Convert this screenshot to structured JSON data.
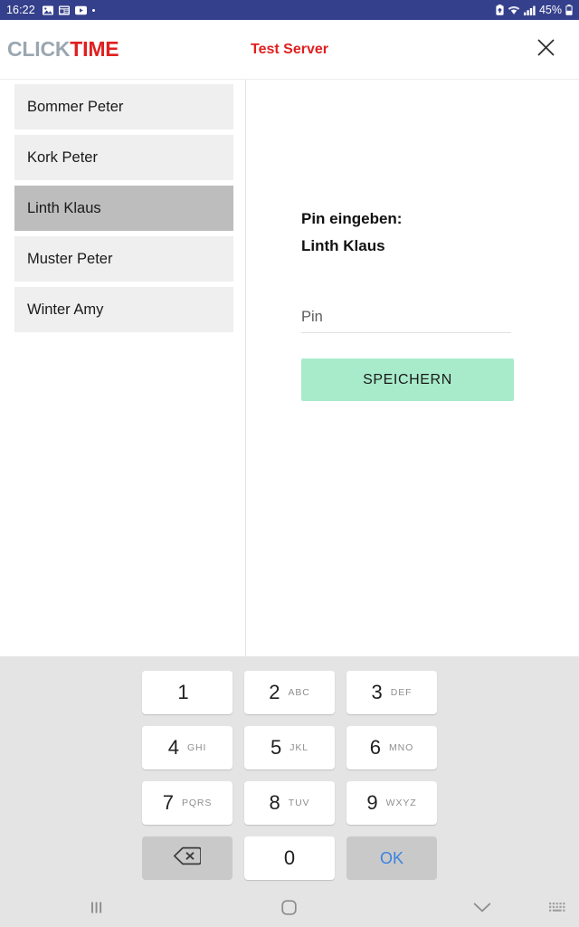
{
  "status_bar": {
    "time": "16:22",
    "battery_percent": "45%",
    "left_icons": [
      "image-icon",
      "news-icon",
      "video-icon",
      "dot-indicator"
    ],
    "right_icons": [
      "battery-saver-icon",
      "wifi-icon",
      "signal-icon",
      "battery-icon"
    ],
    "background_color": "#35408c"
  },
  "app_bar": {
    "logo_part1": "CLICK",
    "logo_part2": "TIME",
    "logo_color1": "#9aa7b0",
    "logo_color2": "#e02020",
    "title": "Test Server",
    "title_color": "#e02020",
    "close_label": "close-icon"
  },
  "user_list": {
    "items": [
      {
        "label": "Bommer Peter",
        "selected": false
      },
      {
        "label": "Kork Peter",
        "selected": false
      },
      {
        "label": "Linth Klaus",
        "selected": true
      },
      {
        "label": "Muster Peter",
        "selected": false
      },
      {
        "label": "Winter Amy",
        "selected": false
      }
    ]
  },
  "pin_panel": {
    "prompt": "Pin eingeben:",
    "user_name": "Linth Klaus",
    "input_value": "",
    "input_placeholder": "Pin",
    "save_label": "SPEICHERN",
    "save_color": "#a8ebca"
  },
  "keypad": {
    "keys": [
      {
        "num": "1",
        "letters": ""
      },
      {
        "num": "2",
        "letters": "ABC"
      },
      {
        "num": "3",
        "letters": "DEF"
      },
      {
        "num": "4",
        "letters": "GHI"
      },
      {
        "num": "5",
        "letters": "JKL"
      },
      {
        "num": "6",
        "letters": "MNO"
      },
      {
        "num": "7",
        "letters": "PQRS"
      },
      {
        "num": "8",
        "letters": "TUV"
      },
      {
        "num": "9",
        "letters": "WXYZ"
      }
    ],
    "backspace_label": "backspace-icon",
    "zero": "0",
    "ok_label": "OK",
    "ok_color": "#3b82e0",
    "background_color": "#e4e4e4"
  },
  "nav_bar": {
    "recents_label": "recents-icon",
    "home_label": "home-icon",
    "back_label": "chevron-down-icon",
    "keyboard_switch_label": "keyboard-switch-icon"
  }
}
